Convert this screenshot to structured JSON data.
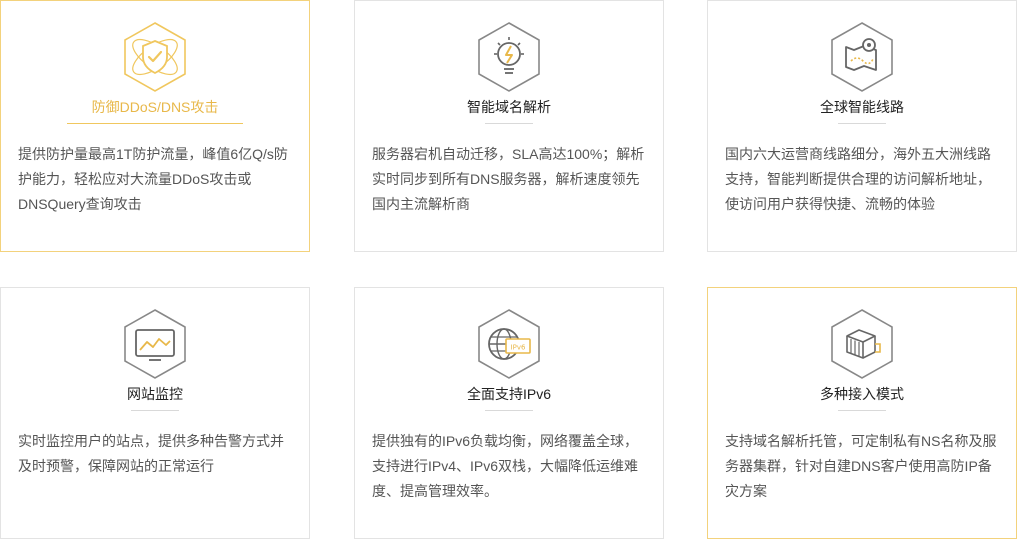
{
  "features": [
    {
      "title": "防御DDoS/DNS攻击",
      "icon": "shield-check-icon",
      "active": true,
      "desc": "提供防护量最高1T防护流量，峰值6亿Q/s防护能力，轻松应对大流量DDoS攻击或DNSQuery查询攻击"
    },
    {
      "title": "智能域名解析",
      "icon": "lightbulb-icon",
      "active": false,
      "desc": "服务器宕机自动迁移，SLA高达100%；解析实时同步到所有DNS服务器，解析速度领先国内主流解析商"
    },
    {
      "title": "全球智能线路",
      "icon": "map-route-icon",
      "active": false,
      "desc": "国内六大运营商线路细分，海外五大洲线路支持，智能判断提供合理的访问解析地址，使访问用户获得快捷、流畅的体验"
    },
    {
      "title": "网站监控",
      "icon": "monitor-chart-icon",
      "active": false,
      "desc": "实时监控用户的站点，提供多种告警方式并及时预警，保障网站的正常运行"
    },
    {
      "title": "全面支持IPv6",
      "icon": "globe-ipv6-icon",
      "active": false,
      "badge": "IPv6",
      "desc": "提供独有的IPv6负载均衡，网络覆盖全球，支持进行IPv4、IPv6双栈，大幅降低运维难度、提高管理效率。"
    },
    {
      "title": "多种接入模式",
      "icon": "server-stack-icon",
      "active": false,
      "desc": "支持域名解析托管，可定制私有NS名称及服务器集群，针对自建DNS客户使用高防IP备灾方案"
    }
  ],
  "colors": {
    "accent": "#e8b84a",
    "accent_line": "#f0c75e",
    "icon_gray": "#777777",
    "border": "#e3e3e3",
    "text": "#555555"
  }
}
